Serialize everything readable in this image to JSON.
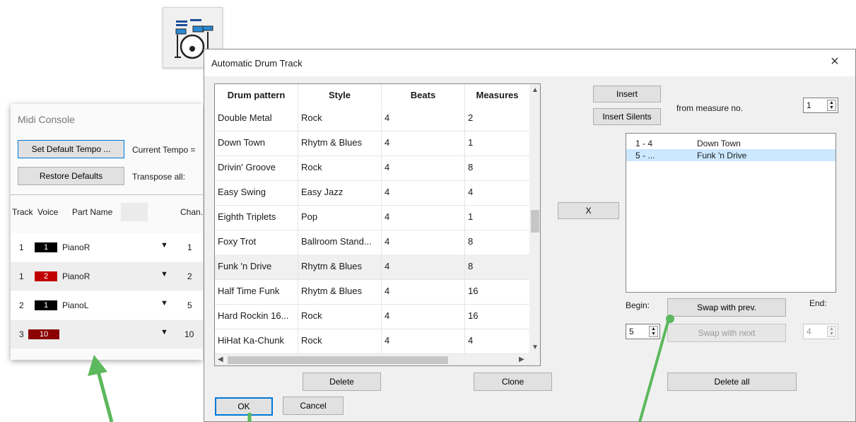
{
  "colors": {
    "accent": "#0078d7",
    "arrow": "#5cb85c",
    "chip_black": "#000000",
    "chip_red": "#c00000",
    "chip_darkred": "#8b0000",
    "selection": "#cce8ff"
  },
  "toolbar_icon": {
    "name": "drum-kit-icon"
  },
  "midi_console": {
    "title": "Midi Console",
    "set_tempo_label": "Set Default Tempo ...",
    "current_tempo_label": "Current Tempo =",
    "restore_label": "Restore Defaults",
    "transpose_label": "Transpose all:",
    "headers": {
      "track": "Track",
      "voice": "Voice",
      "part": "Part Name",
      "chan": "Chan."
    },
    "rows": [
      {
        "track": "1",
        "voice": "1",
        "part": "PianoR",
        "chan": "1",
        "chip_color": "#000000"
      },
      {
        "track": "1",
        "voice": "2",
        "part": "PianoR",
        "chan": "2",
        "chip_color": "#c00000"
      },
      {
        "track": "2",
        "voice": "1",
        "part": "PianoL",
        "chan": "5",
        "chip_color": "#000000"
      },
      {
        "track": "3",
        "voice": "10",
        "part": "",
        "chan": "10",
        "chip_color": "#8b0000"
      }
    ]
  },
  "dialog": {
    "title": "Automatic Drum Track",
    "close_symbol": "×",
    "grid": {
      "headers": [
        "Drum pattern",
        "Style",
        "Beats",
        "Measures"
      ],
      "rows": [
        [
          "Double Metal",
          "Rock",
          "4",
          "2"
        ],
        [
          "Down Town",
          "Rhytm & Blues",
          "4",
          "1"
        ],
        [
          "Drivin' Groove",
          "Rock",
          "4",
          "8"
        ],
        [
          "Easy Swing",
          "Easy Jazz",
          "4",
          "4"
        ],
        [
          "Eighth Triplets",
          "Pop",
          "4",
          "1"
        ],
        [
          "Foxy Trot",
          "Ballroom Stand...",
          "4",
          "8"
        ],
        [
          "Funk 'n Drive",
          "Rhytm & Blues",
          "4",
          "8"
        ],
        [
          "Half Time Funk",
          "Rhytm & Blues",
          "4",
          "16"
        ],
        [
          "Hard Rockin 16...",
          "Rock",
          "4",
          "16"
        ],
        [
          "HiHat Ka-Chunk",
          "Rock",
          "4",
          "4"
        ]
      ],
      "selected_row": 6
    },
    "insert_label": "Insert",
    "insert_silents_label": "Insert Silents",
    "from_measure_label": "from measure no.",
    "from_measure_value": "1",
    "x_label": "X",
    "assignments": [
      {
        "range": "1 - 4",
        "pattern": "Down Town"
      },
      {
        "range": "5 - ...",
        "pattern": "Funk 'n Drive"
      }
    ],
    "begin_label": "Begin:",
    "begin_value": "5",
    "end_label": "End:",
    "end_value": "4",
    "swap_prev_label": "Swap with prev.",
    "swap_next_label": "Swap with next",
    "delete_label": "Delete",
    "clone_label": "Clone",
    "delete_all_label": "Delete all",
    "ok_label": "OK",
    "cancel_label": "Cancel"
  }
}
